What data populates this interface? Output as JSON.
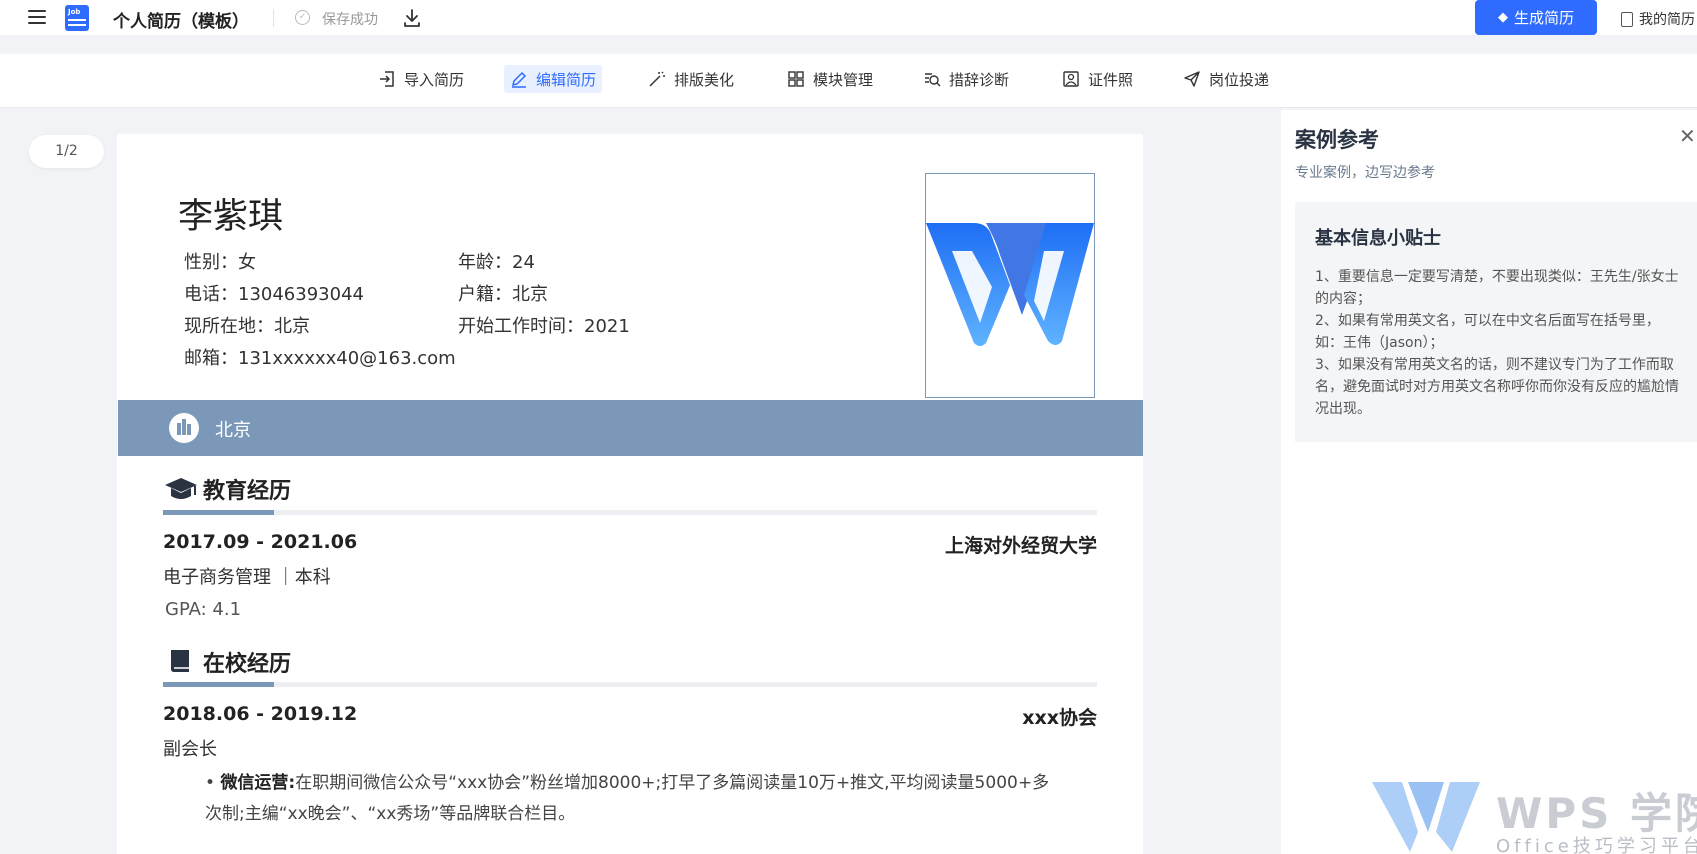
{
  "topbar": {
    "title": "个人简历（模板）",
    "saved": "保存成功",
    "generate": "生成简历",
    "my_resume": "我的简历",
    "doc_icon_label": "Job"
  },
  "toolbar": {
    "items": [
      {
        "label": "导入简历",
        "icon": "import-icon"
      },
      {
        "label": "编辑简历",
        "icon": "edit-icon",
        "active": true
      },
      {
        "label": "排版美化",
        "icon": "magic-wand-icon"
      },
      {
        "label": "模块管理",
        "icon": "grid-icon"
      },
      {
        "label": "措辞诊断",
        "icon": "diagnose-icon"
      },
      {
        "label": "证件照",
        "icon": "id-photo-icon"
      },
      {
        "label": "岗位投递",
        "icon": "send-icon"
      }
    ]
  },
  "page_indicator": "1/2",
  "resume": {
    "name": "李紫琪",
    "info": {
      "gender": "性别：女",
      "age": "年龄：24",
      "phone": "电话：13046393044",
      "hukou": "户籍：北京",
      "location": "现所在地：北京",
      "start_work": "开始工作时间：2021",
      "email": "邮箱：131xxxxxx40@163.com"
    },
    "city": "北京",
    "education": {
      "title": "教育经历",
      "period": "2017.09  -  2021.06",
      "school": "上海对外经贸大学",
      "major": "电子商务管理  ｜本科",
      "gpa": "GPA: 4.1"
    },
    "campus": {
      "title": "在校经历",
      "period": "2018.06  -  2019.12",
      "org": "xxx协会",
      "role": "副会长",
      "bullet_label": "微信运营:",
      "bullet_text": "在职期间微信公众号“xxx协会”粉丝增加8000+;打早了多篇阅读量10万+推文,平均阅读量5000+多次制;主编“xx晚会”、“xx秀场”等品牌联合栏目。"
    }
  },
  "panel": {
    "title": "案例参考",
    "subtitle": "专业案例，边写边参考",
    "tip_title": "基本信息小贴士",
    "tip_text": "1、重要信息一定要写清楚，不要出现类似：王先生/张女士 的内容；\n2、如果有常用英文名，可以在中文名后面写在括号里，如：王伟（Jason）；\n3、如果没有常用英文名的话，则不建议专门为了工作而取名，避免面试时对方用英文名称呼你而你没有反应的尴尬情况出现。"
  },
  "watermark": {
    "title": "WPS 学院",
    "subtitle": "Office技巧学习平台"
  },
  "colors": {
    "accent": "#2f6bff",
    "band": "#7b98b8",
    "background": "#f1f3f6"
  }
}
